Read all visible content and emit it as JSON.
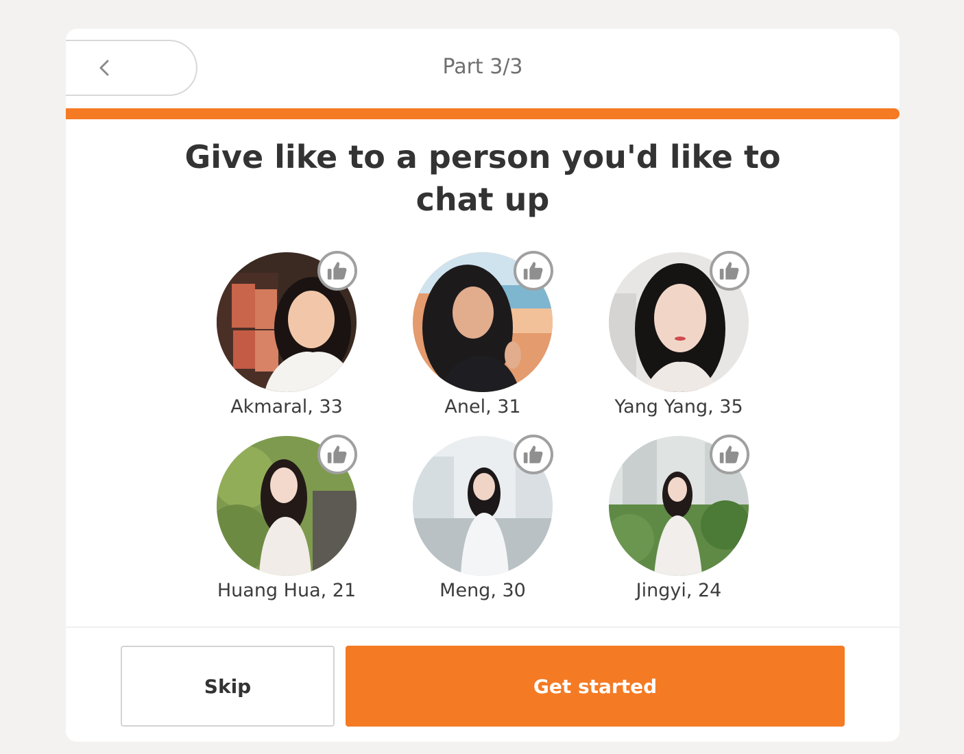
{
  "header": {
    "back_icon": "chevron-left-icon",
    "step_label": "Part 3/3",
    "progress": 1.0,
    "accent_color": "#f47a24"
  },
  "main": {
    "title": "Give like to a person you'd like to chat up",
    "like_icon": "thumbs-up-icon",
    "profiles": [
      {
        "label": "Akmaral, 33"
      },
      {
        "label": "Anel, 31"
      },
      {
        "label": "Yang Yang, 35"
      },
      {
        "label": "Huang Hua, 21"
      },
      {
        "label": "Meng, 30"
      },
      {
        "label": "Jingyi, 24"
      }
    ]
  },
  "footer": {
    "skip_label": "Skip",
    "primary_label": "Get started"
  }
}
